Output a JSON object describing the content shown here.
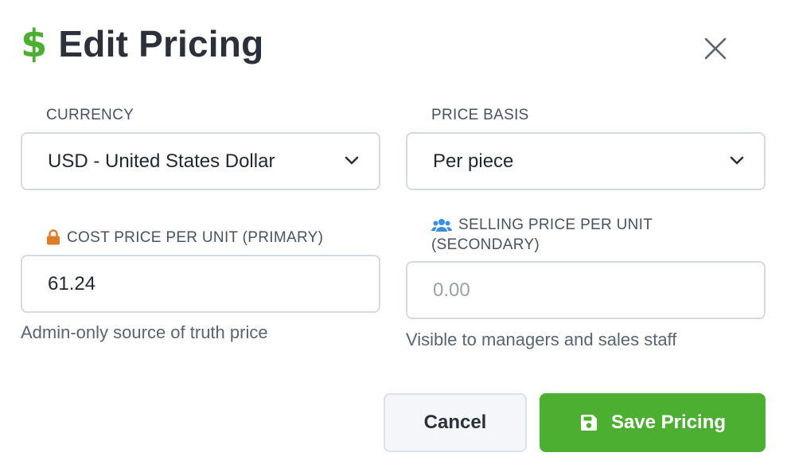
{
  "dialog": {
    "title": "Edit Pricing",
    "title_icon": "dollar-icon",
    "close_icon": "close-icon"
  },
  "colors": {
    "brand_green": "#4caf32",
    "lock_orange": "#e07b2a",
    "users_blue": "#3b8fe0"
  },
  "currency": {
    "label": "CURRENCY",
    "selected": "USD - United States Dollar"
  },
  "price_basis": {
    "label": "PRICE BASIS",
    "selected": "Per piece"
  },
  "cost_price": {
    "icon": "lock-icon",
    "label": "COST PRICE PER UNIT (PRIMARY)",
    "value": "61.24",
    "hint": "Admin-only source of truth price"
  },
  "selling_price": {
    "icon": "users-icon",
    "label_line1": "SELLING PRICE PER UNIT",
    "label_line2": "(SECONDARY)",
    "placeholder": "0.00",
    "hint": "Visible to managers and sales staff"
  },
  "actions": {
    "cancel_label": "Cancel",
    "save_label": "Save Pricing",
    "save_icon": "floppy-disk-icon"
  }
}
